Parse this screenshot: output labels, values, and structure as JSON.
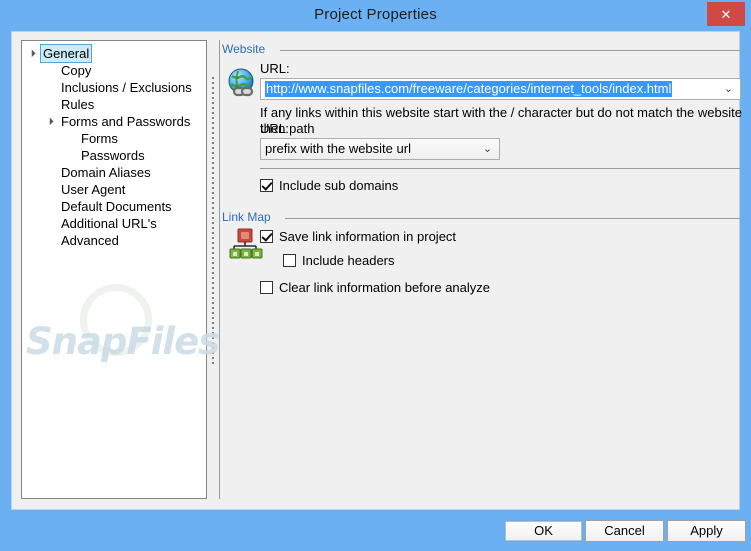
{
  "window": {
    "title": "Project Properties",
    "close_label": "✕",
    "titlebar_color": "#6ab0f3",
    "close_color": "#cf4a45",
    "accent_color": "#2a6fb5"
  },
  "tree": {
    "name": "settings-tree",
    "items": [
      {
        "label": "General",
        "indent": 0,
        "expander": "▲",
        "selected": true
      },
      {
        "label": "Copy",
        "indent": 1,
        "expander": "",
        "selected": false
      },
      {
        "label": "Inclusions / Exclusions",
        "indent": 1,
        "expander": "",
        "selected": false
      },
      {
        "label": "Rules",
        "indent": 1,
        "expander": "",
        "selected": false
      },
      {
        "label": "Forms and Passwords",
        "indent": 1,
        "expander": "▲",
        "selected": false
      },
      {
        "label": "Forms",
        "indent": 2,
        "expander": "",
        "selected": false
      },
      {
        "label": "Passwords",
        "indent": 2,
        "expander": "",
        "selected": false
      },
      {
        "label": "Domain Aliases",
        "indent": 1,
        "expander": "",
        "selected": false
      },
      {
        "label": "User Agent",
        "indent": 1,
        "expander": "",
        "selected": false
      },
      {
        "label": "Default Documents",
        "indent": 1,
        "expander": "",
        "selected": false
      },
      {
        "label": "Additional URL's",
        "indent": 1,
        "expander": "",
        "selected": false
      },
      {
        "label": "Advanced",
        "indent": 1,
        "expander": "",
        "selected": false
      }
    ]
  },
  "website": {
    "group_label": "Website",
    "icon": "globe-link-icon",
    "url_label": "URL:",
    "url_value": "http://www.snapfiles.com/freeware/categories/internet_tools/index.html",
    "url_selected": true,
    "hint_line1": "If any links within this website start with the / character but do not match the website URL path",
    "hint_line2": "then:",
    "prefix_option": "prefix with the website url",
    "include_sub_domains": {
      "label": "Include sub domains",
      "checked": true
    }
  },
  "link_map": {
    "group_label": "Link Map",
    "icon": "link-map-tree-icon",
    "save_link_info": {
      "label": "Save link information in project",
      "checked": true
    },
    "include_headers": {
      "label": "Include headers",
      "checked": false
    },
    "clear_link_info": {
      "label": "Clear link information before analyze",
      "checked": false
    }
  },
  "watermark": {
    "text": "SnapFiles"
  },
  "buttons": {
    "ok": "OK",
    "cancel": "Cancel",
    "apply": "Apply"
  }
}
